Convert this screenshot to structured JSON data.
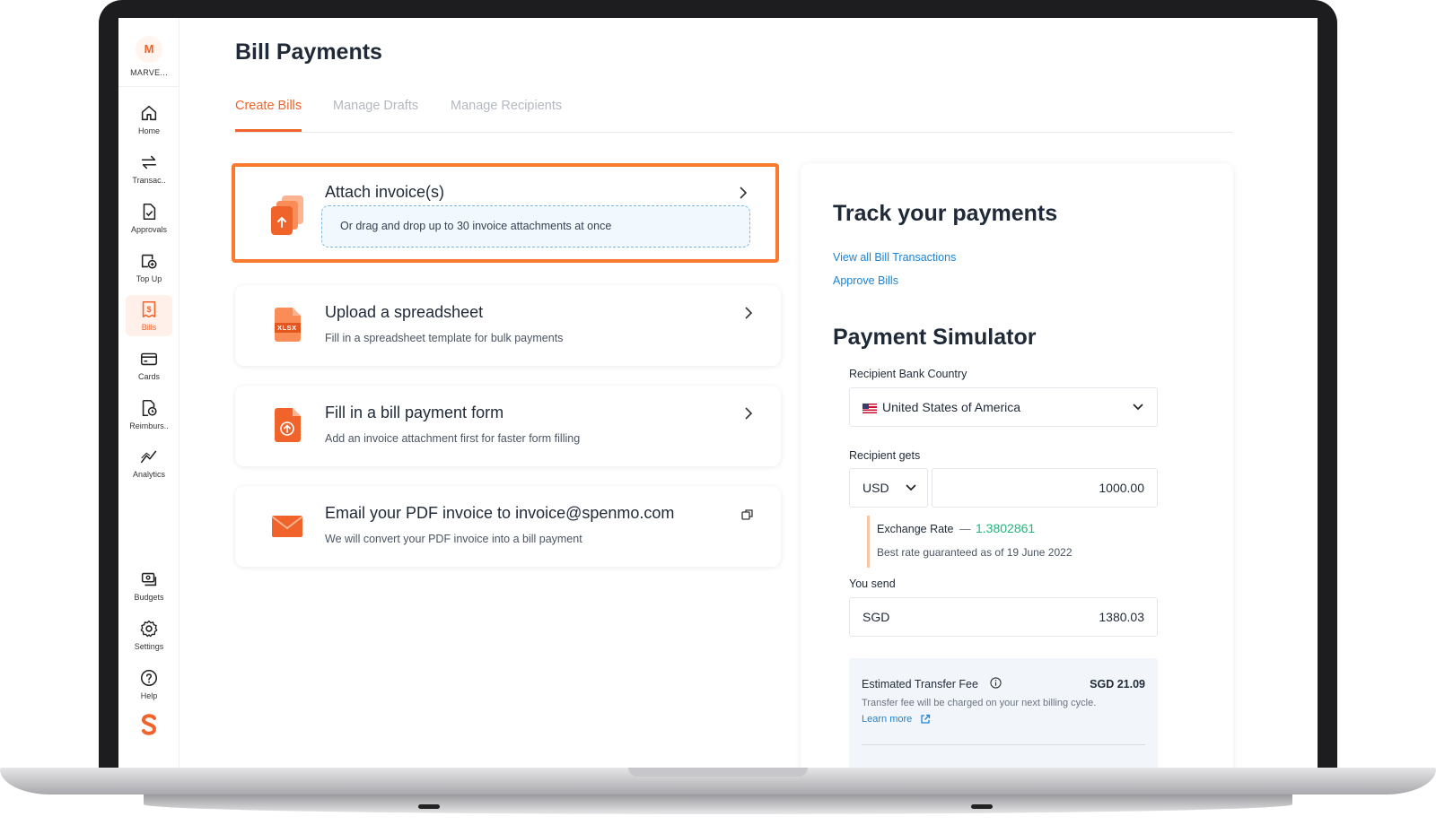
{
  "org": {
    "initial": "M",
    "name": "MARVE..."
  },
  "nav": {
    "top": [
      {
        "label": "Home",
        "icon": "home-icon"
      },
      {
        "label": "Transac..",
        "icon": "transfer-arrows-icon"
      },
      {
        "label": "Approvals",
        "icon": "document-check-icon"
      },
      {
        "label": "Top Up",
        "icon": "wallet-plus-icon"
      },
      {
        "label": "Bills",
        "icon": "bill-dollar-icon",
        "active": true
      },
      {
        "label": "Cards",
        "icon": "card-icon"
      },
      {
        "label": "Reimburs..",
        "icon": "reimbursement-icon"
      },
      {
        "label": "Analytics",
        "icon": "analytics-line-icon"
      }
    ],
    "bottom": [
      {
        "label": "Budgets",
        "icon": "budget-icon"
      },
      {
        "label": "Settings",
        "icon": "gear-icon"
      },
      {
        "label": "Help",
        "icon": "help-icon"
      }
    ]
  },
  "page": {
    "title": "Bill Payments"
  },
  "tabs": [
    {
      "label": "Create Bills",
      "active": true
    },
    {
      "label": "Manage Drafts"
    },
    {
      "label": "Manage Recipients"
    }
  ],
  "cards": {
    "attach": {
      "title": "Attach invoice(s)",
      "dropzone": "Or drag and drop up to 30 invoice attachments at once"
    },
    "spreadsheet": {
      "title": "Upload a spreadsheet",
      "desc": "Fill in a spreadsheet template for bulk payments",
      "badge": "XLSX"
    },
    "form": {
      "title": "Fill in a bill payment form",
      "desc": "Add an invoice attachment first for faster form filling"
    },
    "email": {
      "title": "Email your PDF invoice to invoice@spenmo.com",
      "desc": "We will convert your PDF invoice into a bill payment"
    }
  },
  "panel": {
    "track_title": "Track your payments",
    "link_view_all": "View all Bill Transactions",
    "link_approve": "Approve Bills",
    "simulator_title": "Payment Simulator",
    "country_label": "Recipient Bank Country",
    "country_value": "United States of America",
    "gets_label": "Recipient gets",
    "gets_currency": "USD",
    "gets_amount": "1000.00",
    "rate_label": "Exchange Rate",
    "rate_dash": "—",
    "rate_value": "1.3802861",
    "rate_note": "Best rate guaranteed as of 19 June 2022",
    "send_label": "You send",
    "send_currency": "SGD",
    "send_amount": "1380.03",
    "fee_label": "Estimated Transfer Fee",
    "fee_value": "SGD 21.09",
    "fee_note": "Transfer fee will be charged on your next billing cycle.",
    "learn_more": "Learn more"
  },
  "colors": {
    "accent": "#f0642c",
    "link": "#1b84d8",
    "rate": "#20b47a"
  }
}
